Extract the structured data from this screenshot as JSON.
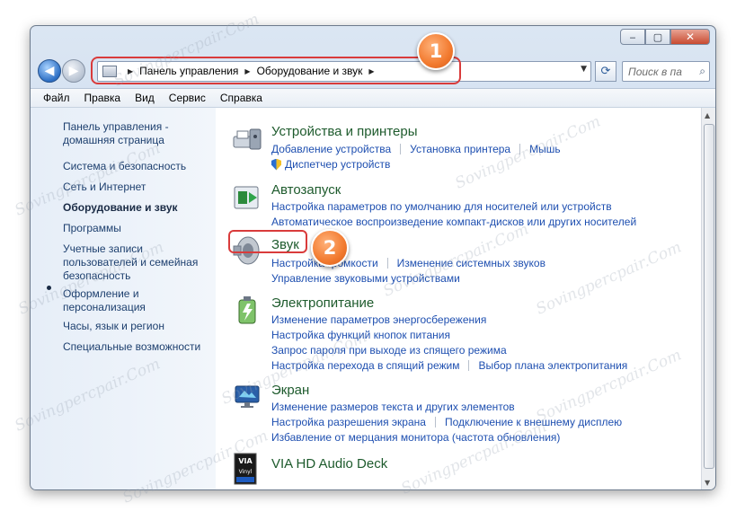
{
  "caption_buttons": {
    "minimize": "‒",
    "maximize": "▢",
    "close": "✕"
  },
  "address_bar": {
    "crumbs": [
      "Панель управления",
      "Оборудование и звук"
    ]
  },
  "search": {
    "placeholder": "Поиск в па"
  },
  "menu": [
    "Файл",
    "Правка",
    "Вид",
    "Сервис",
    "Справка"
  ],
  "sidebar": {
    "home": "Панель управления - домашняя страница",
    "items": [
      "Система и безопасность",
      "Сеть и Интернет",
      "Оборудование и звук",
      "Программы",
      "Учетные записи пользователей и семейная безопасность",
      "Оформление и персонализация",
      "Часы, язык и регион",
      "Специальные возможности"
    ],
    "active_index": 2
  },
  "sections": [
    {
      "title": "Устройства и принтеры",
      "links": [
        [
          "Добавление устройства",
          "Установка принтера",
          "Мышь"
        ],
        [
          "Диспетчер устройств"
        ]
      ]
    },
    {
      "title": "Автозапуск",
      "links": [
        [
          "Настройка параметров по умолчанию для носителей или устройств"
        ],
        [
          "Автоматическое воспроизведение компакт-дисков или других носителей"
        ]
      ]
    },
    {
      "title": "Звук",
      "links": [
        [
          "Настройка громкости",
          "Изменение системных звуков"
        ],
        [
          "Управление звуковыми устройствами"
        ]
      ]
    },
    {
      "title": "Электропитание",
      "links": [
        [
          "Изменение параметров энергосбережения"
        ],
        [
          "Настройка функций кнопок питания"
        ],
        [
          "Запрос пароля при выходе из спящего режима"
        ],
        [
          "Настройка перехода в спящий режим",
          "Выбор плана электропитания"
        ]
      ]
    },
    {
      "title": "Экран",
      "links": [
        [
          "Изменение размеров текста и других элементов"
        ],
        [
          "Настройка разрешения экрана",
          "Подключение к внешнему дисплею"
        ],
        [
          "Избавление от мерцания монитора (частота обновления)"
        ]
      ]
    },
    {
      "title": "VIA HD Audio Deck",
      "links": []
    }
  ],
  "badges": {
    "one": "1",
    "two": "2"
  },
  "watermark": "Sovingpercpair.Com",
  "colors": {
    "section_title": "#1e5b2d",
    "link": "#1e4fb0",
    "callout": "#d93b3b",
    "badge": "#f27a2f"
  }
}
